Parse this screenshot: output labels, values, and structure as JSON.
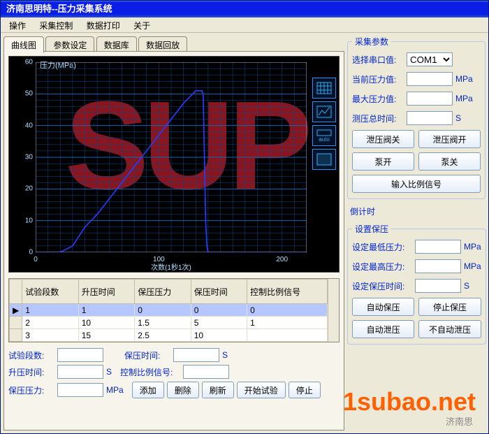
{
  "window": {
    "title": "济南思明特--压力采集系统"
  },
  "menu": [
    "操作",
    "采集控制",
    "数据打印",
    "关于"
  ],
  "tabs": [
    "曲线图",
    "参数设定",
    "数据库",
    "数据回放"
  ],
  "chart_data": {
    "type": "line",
    "title": "压力(MPa)",
    "xlabel": "",
    "xlabel_sub": "次数(1秒1次)",
    "ylabel": "",
    "xlim": [
      0,
      220
    ],
    "ylim": [
      0,
      60
    ],
    "x_ticks": [
      0,
      100,
      200
    ],
    "y_ticks": [
      0,
      10,
      20,
      30,
      40,
      50,
      60
    ],
    "series": [
      {
        "name": "压力",
        "color": "#2a3aff",
        "x": [
          0,
          20,
          30,
          40,
          50,
          60,
          70,
          80,
          90,
          100,
          110,
          120,
          125,
          130,
          135,
          136,
          137,
          138,
          139,
          140,
          220
        ],
        "y": [
          0,
          0,
          2,
          8,
          12,
          17,
          22,
          27,
          32,
          37,
          42,
          47,
          49,
          51,
          51,
          50,
          30,
          10,
          2,
          0,
          0
        ]
      }
    ]
  },
  "chart_controls": [
    {
      "name": "grid-icon"
    },
    {
      "name": "chart-style-icon"
    },
    {
      "name": "auto-icon",
      "label": "auto"
    },
    {
      "name": "color-icon"
    }
  ],
  "table": {
    "headers": [
      "试验段数",
      "升压时间",
      "保压压力",
      "保压时间",
      "控制比例信号"
    ],
    "rows": [
      [
        "1",
        "1",
        "0",
        "0",
        "0"
      ],
      [
        "2",
        "10",
        "1.5",
        "5",
        "1"
      ],
      [
        "3",
        "15",
        "2.5",
        "10",
        ""
      ]
    ],
    "selected_row": 0
  },
  "bottom_form": {
    "labels": {
      "seg_count": "试验段数:",
      "hold_time": "保压时间:",
      "rise_time": "升压时间:",
      "ctrl_sig": "控制比例信号:",
      "hold_pres": "保压压力:"
    },
    "units": {
      "s": "S",
      "mpa": "MPa"
    },
    "buttons": {
      "add": "添加",
      "del": "删除",
      "refresh": "刷新",
      "start": "开始试验",
      "stop": "停止"
    }
  },
  "right": {
    "collect": {
      "legend": "采集参数",
      "port_lbl": "选择串口值:",
      "port_val": "COM1",
      "cur_lbl": "当前压力值:",
      "cur_unit": "MPa",
      "max_lbl": "最大压力值:",
      "max_unit": "MPa",
      "time_lbl": "测压总时间:",
      "time_unit": "S",
      "btn_relief_close": "泄压阀关",
      "btn_relief_open": "泄压阀开",
      "btn_pump_on": "泵开",
      "btn_pump_off": "泵关",
      "btn_input_ratio": "输入比例信号"
    },
    "countdown_lbl": "倒计时",
    "holdset": {
      "legend": "设置保压",
      "min_lbl": "设定最低压力:",
      "min_unit": "MPa",
      "max_lbl": "设定最高压力:",
      "max_unit": "MPa",
      "time_lbl": "设定保压时间:",
      "time_unit": "S",
      "btn_auto_hold": "自动保压",
      "btn_stop_hold": "停止保压",
      "btn_auto_relief": "自动泄压",
      "btn_no_relief": "不自动泄压"
    }
  },
  "watermarks": {
    "sup": "SUP",
    "logo": "1subao.net",
    "footer1": "济南思",
    "footer2": ""
  }
}
